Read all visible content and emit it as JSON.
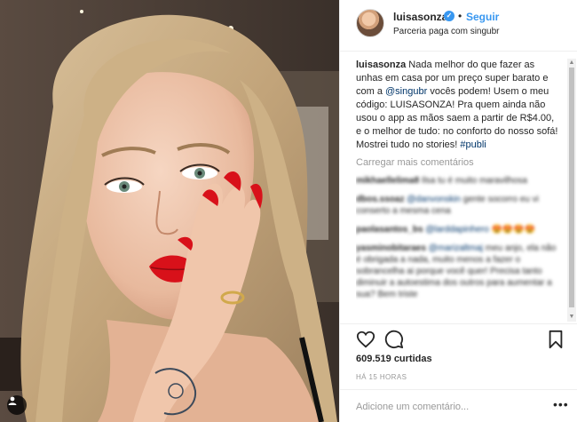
{
  "post": {
    "image_alt": "Selfie of a woman with long blonde hair, red lipstick and long red nails",
    "author": {
      "username": "luisasonza",
      "verified": true,
      "follow_label": "Seguir",
      "separator": "•",
      "subtitle": "Parceria paga com singubr"
    },
    "caption": {
      "username": "luisasonza",
      "part1": " Nada melhor do que fazer as unhas em casa por um preço super barato e com a ",
      "mention": "@singubr",
      "part2": " vocês podem! Usem o meu código: LUISASONZA! Pra quem ainda não usou o app as mãos saem a partir de R$4.00, e o melhor de tudo: no conforto do nosso sofá! Mostrei tudo no stories! ",
      "hashtag": "#publi"
    },
    "load_more_label": "Carregar mais comentários",
    "comments": [
      {
        "user": "mikhaellelima8",
        "mention": "",
        "text": " Ilsa tu é muito maravilhosa"
      },
      {
        "user": "dbos.ssoaz",
        "mention": "@danvonskin",
        "text": " gente socorro eu vi conserto a mesma cena"
      },
      {
        "user": "paolasantos_bs",
        "mention": "@larddapinhero",
        "text": " 😍😍😍😍"
      },
      {
        "user": "yasminobitaraes",
        "mention": "@marizaltmaj",
        "text": " meu anjo, ela não é obrigada a nada, muito menos a fazer o sobrancelha ai porque você quer! Precisa tanto diminuir a autoestima dos outros para aumentar a sua? Bem triste"
      }
    ],
    "likes": "609.519 curtidas",
    "timestamp": "HÁ 15 HORAS",
    "comment_input": {
      "placeholder": "Adicione um comentário...",
      "value": ""
    },
    "more_options": "•••"
  },
  "icons": {
    "like": "heart-icon",
    "comment": "comment-icon",
    "save": "bookmark-icon",
    "tagged": "user-icon",
    "verified": "verified-badge-icon"
  },
  "colors": {
    "link": "#3897f0",
    "mention": "#003569",
    "muted": "#999999",
    "lipstick": "#d8111a"
  }
}
